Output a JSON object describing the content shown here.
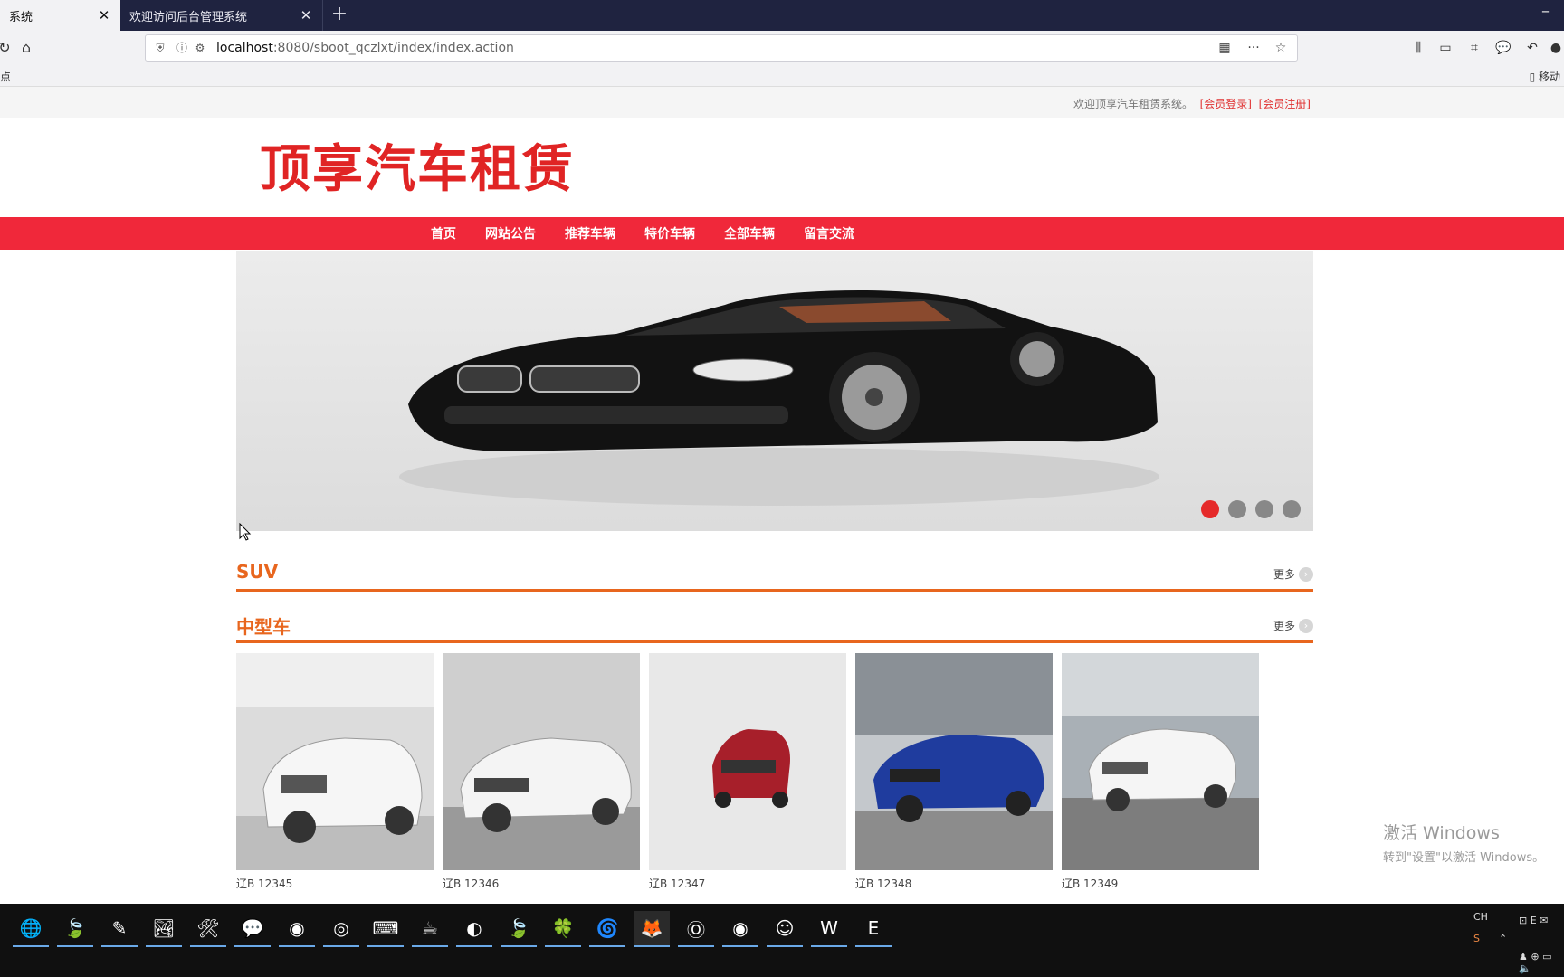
{
  "browser": {
    "tabs": [
      {
        "title": "系统",
        "active": true
      },
      {
        "title": "欢迎访问后台管理系统",
        "active": false
      }
    ],
    "url_host": "localhost",
    "url_rest": ":8080/sboot_qczlxt/index/index.action",
    "bookmarks_left": "点",
    "bookmarks_right": "移动"
  },
  "site": {
    "welcome": "欢迎顶享汽车租赁系统。",
    "login_link": "[会员登录]",
    "register_link": "[会员注册]",
    "logo_text": "顶享汽车租赁",
    "menu": [
      "首页",
      "网站公告",
      "推荐车辆",
      "特价车辆",
      "全部车辆",
      "留言交流"
    ],
    "banner_active_index": 0,
    "banner_dot_count": 4
  },
  "sections": [
    {
      "title": "SUV",
      "more": "更多"
    },
    {
      "title": "中型车",
      "more": "更多"
    }
  ],
  "cars": [
    {
      "plate": "辽B 12345",
      "color": "#f4f4f4"
    },
    {
      "plate": "辽B 12346",
      "color": "#f0f0f0"
    },
    {
      "plate": "辽B 12347",
      "color": "#b0202a"
    },
    {
      "plate": "辽B 12348",
      "color": "#1d3a9c"
    },
    {
      "plate": "辽B 12349",
      "color": "#f2f2f2"
    }
  ],
  "watermark": {
    "line1": "激活 Windows",
    "line2": "转到\"设置\"以激活 Windows。"
  },
  "taskbar": {
    "tray_lang": "CH"
  }
}
